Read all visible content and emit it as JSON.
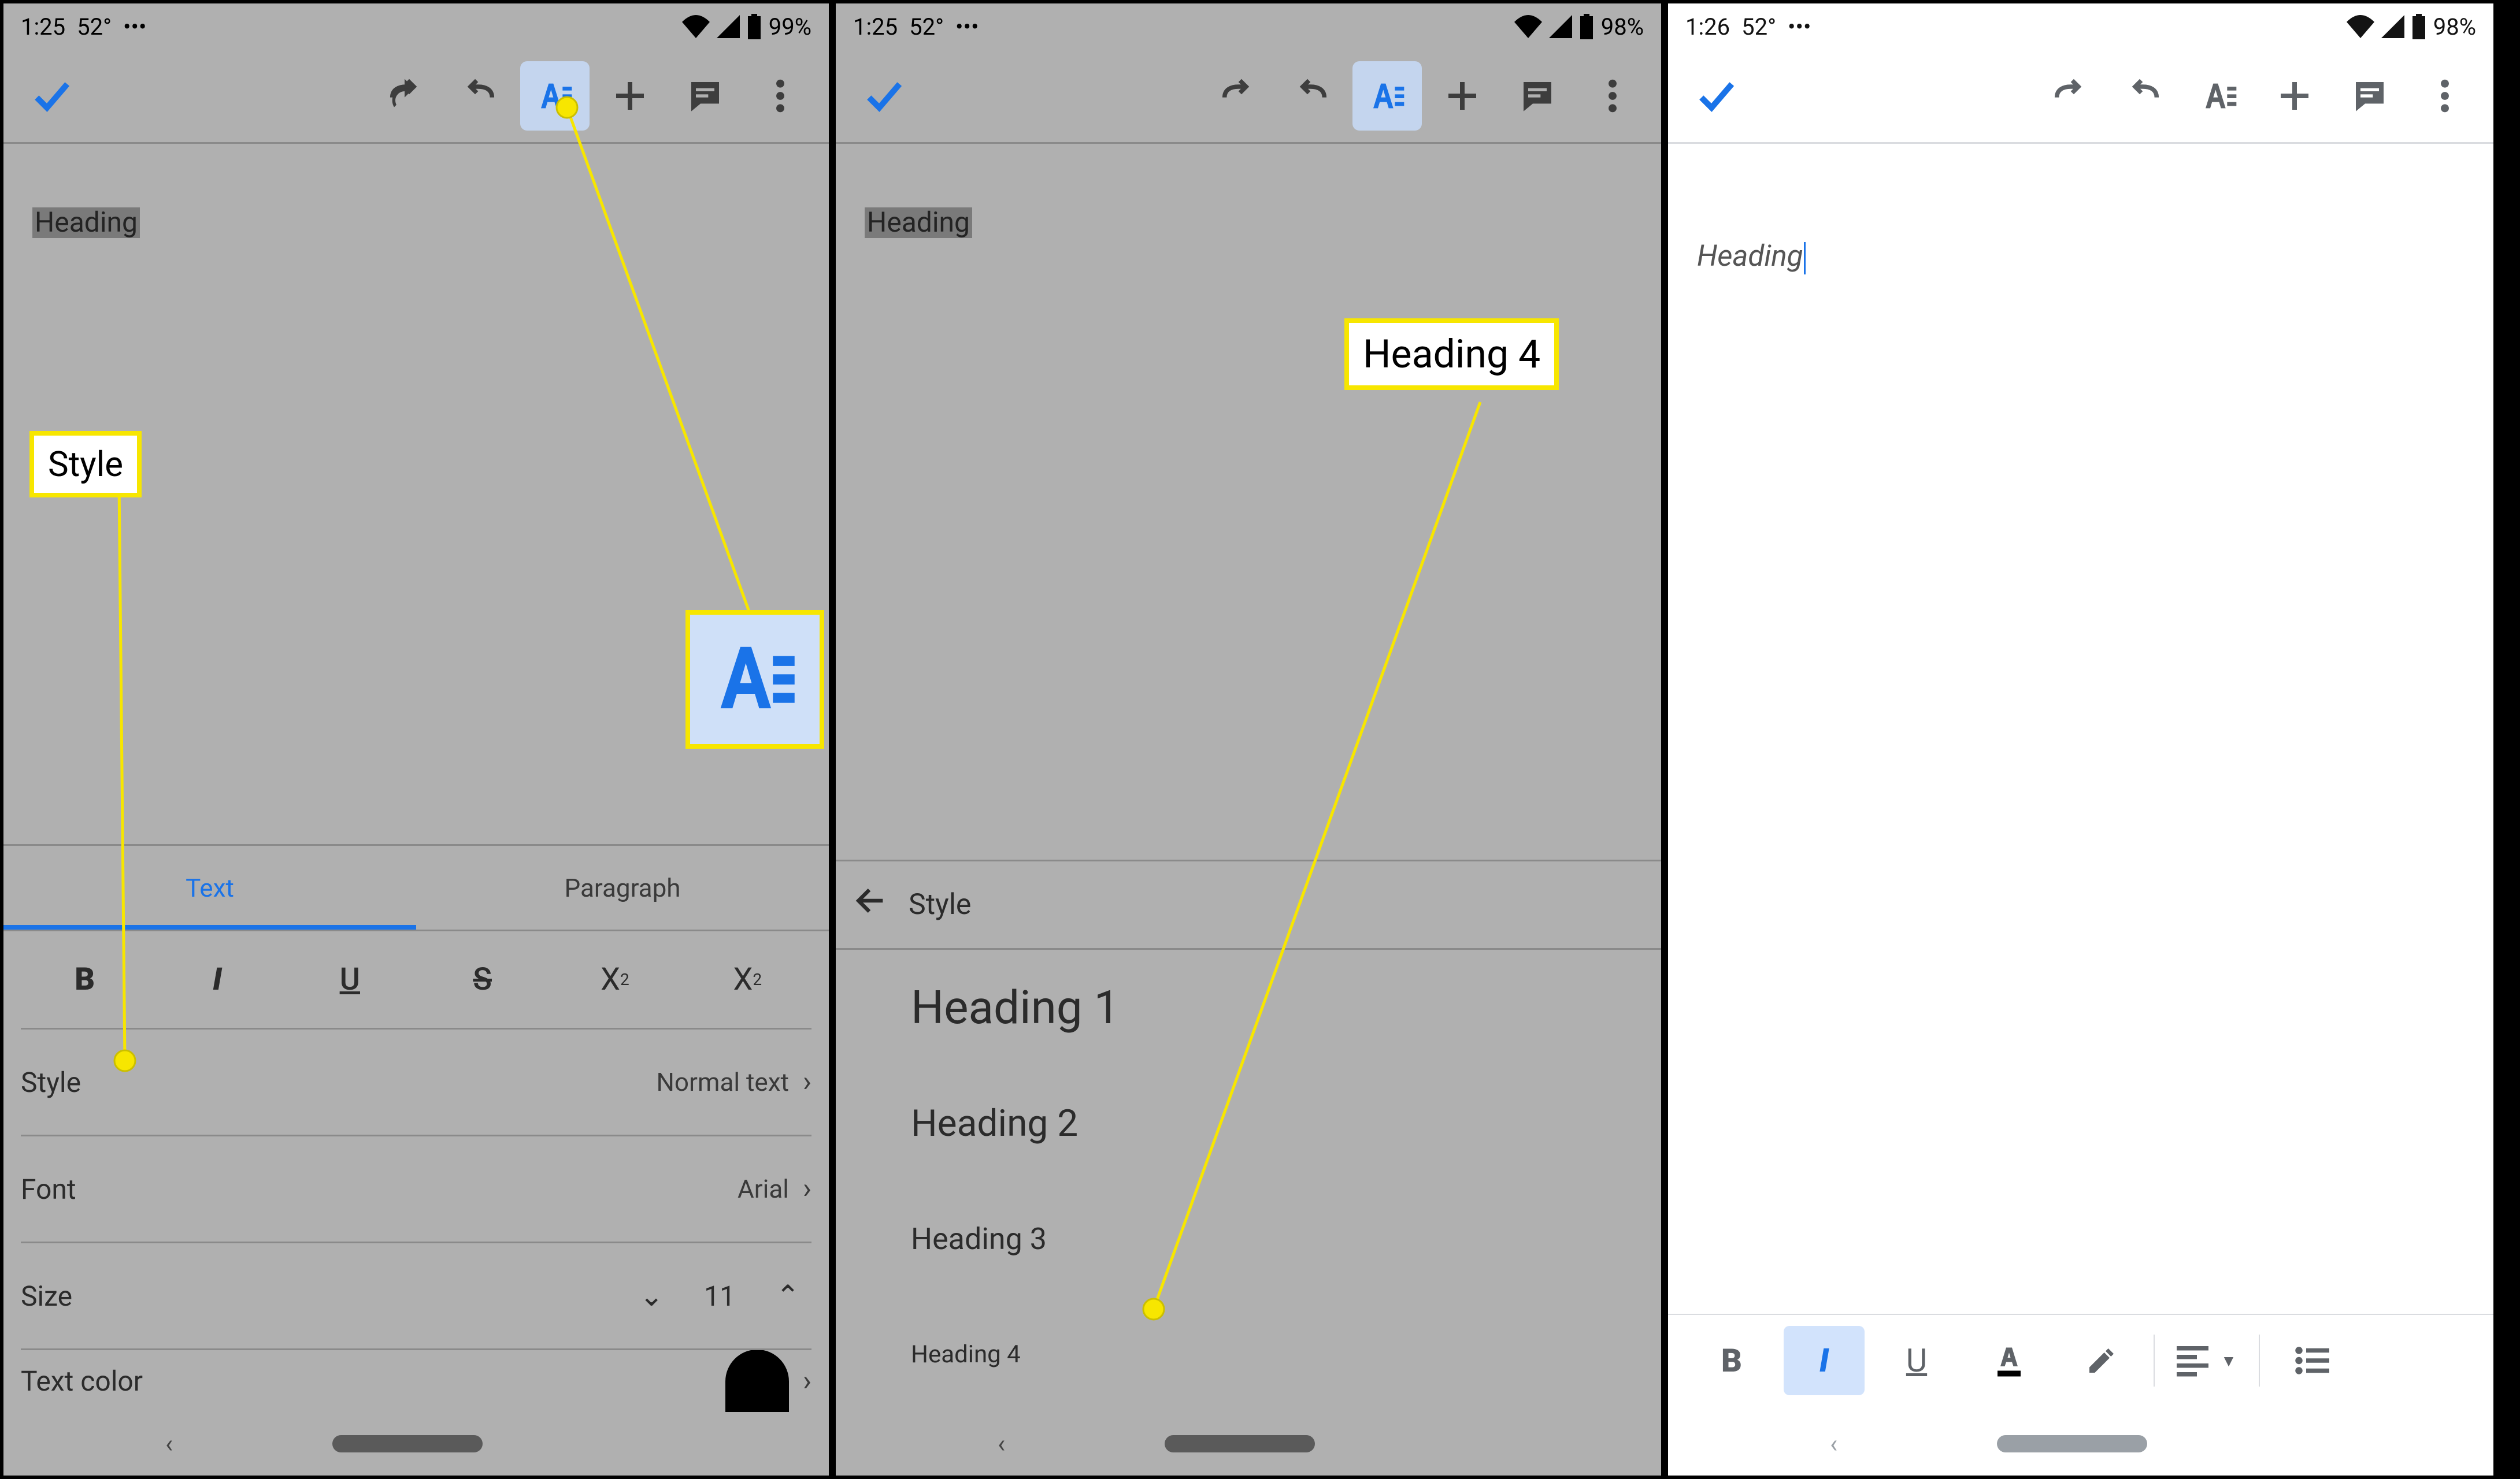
{
  "screens": [
    {
      "status": {
        "time": "1:25",
        "temp": "52°",
        "dots": "•••",
        "battery": "99%"
      },
      "doc_text": "Heading",
      "callouts": {
        "style": "Style"
      },
      "tabs": [
        "Text",
        "Paragraph"
      ],
      "format_btns": [
        "B",
        "I",
        "U",
        "S",
        "X²",
        "X₂"
      ],
      "rows": {
        "style": {
          "label": "Style",
          "value": "Normal text"
        },
        "font": {
          "label": "Font",
          "value": "Arial"
        },
        "size": {
          "label": "Size",
          "value": "11"
        },
        "text_color": {
          "label": "Text color"
        }
      }
    },
    {
      "status": {
        "time": "1:25",
        "temp": "52°",
        "dots": "•••",
        "battery": "98%"
      },
      "doc_text": "Heading",
      "callouts": {
        "h4": "Heading 4"
      },
      "style_header": "Style",
      "styles": [
        "Heading 1",
        "Heading 2",
        "Heading 3",
        "Heading 4"
      ]
    },
    {
      "status": {
        "time": "1:26",
        "temp": "52°",
        "dots": "•••",
        "battery": "98%"
      },
      "doc_text": "Heading"
    }
  ],
  "common": {
    "toolbar_icons": [
      "check",
      "undo",
      "redo",
      "format",
      "add",
      "comment",
      "more"
    ]
  }
}
